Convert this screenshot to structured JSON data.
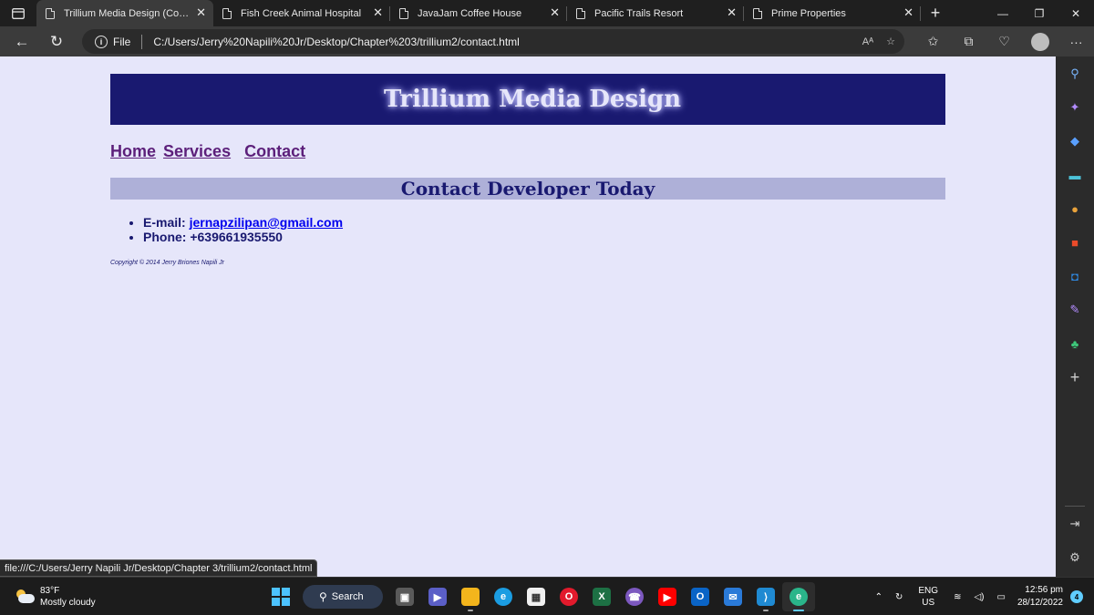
{
  "browser": {
    "tabs": [
      {
        "label": "Trillium Media Design (Conta",
        "active": true
      },
      {
        "label": "Fish Creek Animal Hospital",
        "active": false
      },
      {
        "label": "JavaJam Coffee House",
        "active": false
      },
      {
        "label": "Pacific Trails Resort",
        "active": false
      },
      {
        "label": "Prime Properties",
        "active": false
      }
    ],
    "address": {
      "scheme_label": "File",
      "url": "C:/Users/Jerry%20Napili%20Jr/Desktop/Chapter%203/trillium2/contact.html",
      "read_aloud_label": "Aᴬ"
    },
    "status_url": "file:///C:/Users/Jerry Napili Jr/Desktop/Chapter 3/trillium2/contact.html"
  },
  "page": {
    "site_title": "Trillium Media Design",
    "nav": [
      "Home",
      "Services",
      "Contact"
    ],
    "section_heading": "Contact Developer Today",
    "contact": {
      "email_label": "E-mail:",
      "email_value": "jernapzilipan@gmail.com",
      "phone_label": "Phone:",
      "phone_value": "+639661935550"
    },
    "copyright": "Copyright © 2014 Jerry Briones Napili Jr",
    "colors": {
      "background": "#e6e6fa",
      "header_bg": "#191970",
      "heading_bg": "#aeb0d8",
      "text": "#191970",
      "nav_link": "#5c1f7a"
    }
  },
  "sidebar": {
    "icons": [
      "search-icon",
      "copilot-icon",
      "shopping-tag-icon",
      "tools-icon",
      "games-icon",
      "office-icon",
      "outlook-icon",
      "drop-icon",
      "tree-icon",
      "add-icon",
      "split-screen-icon",
      "settings-icon"
    ]
  },
  "taskbar": {
    "weather": {
      "temp": "83°F",
      "condition": "Mostly cloudy"
    },
    "search_label": "Search",
    "apps": [
      "windows-start-icon",
      "search-icon",
      "task-view-icon",
      "teams-chat-icon",
      "file-explorer-icon",
      "edge-icon",
      "store-icon",
      "opera-icon",
      "excel-icon",
      "viber-icon",
      "youtube-icon",
      "outlook-icon",
      "mail-icon",
      "vscode-icon",
      "edge-dev-icon"
    ],
    "language": {
      "lang": "ENG",
      "region": "US"
    },
    "clock": {
      "time": "12:56 pm",
      "date": "28/12/2022"
    },
    "notification_count": "4"
  }
}
